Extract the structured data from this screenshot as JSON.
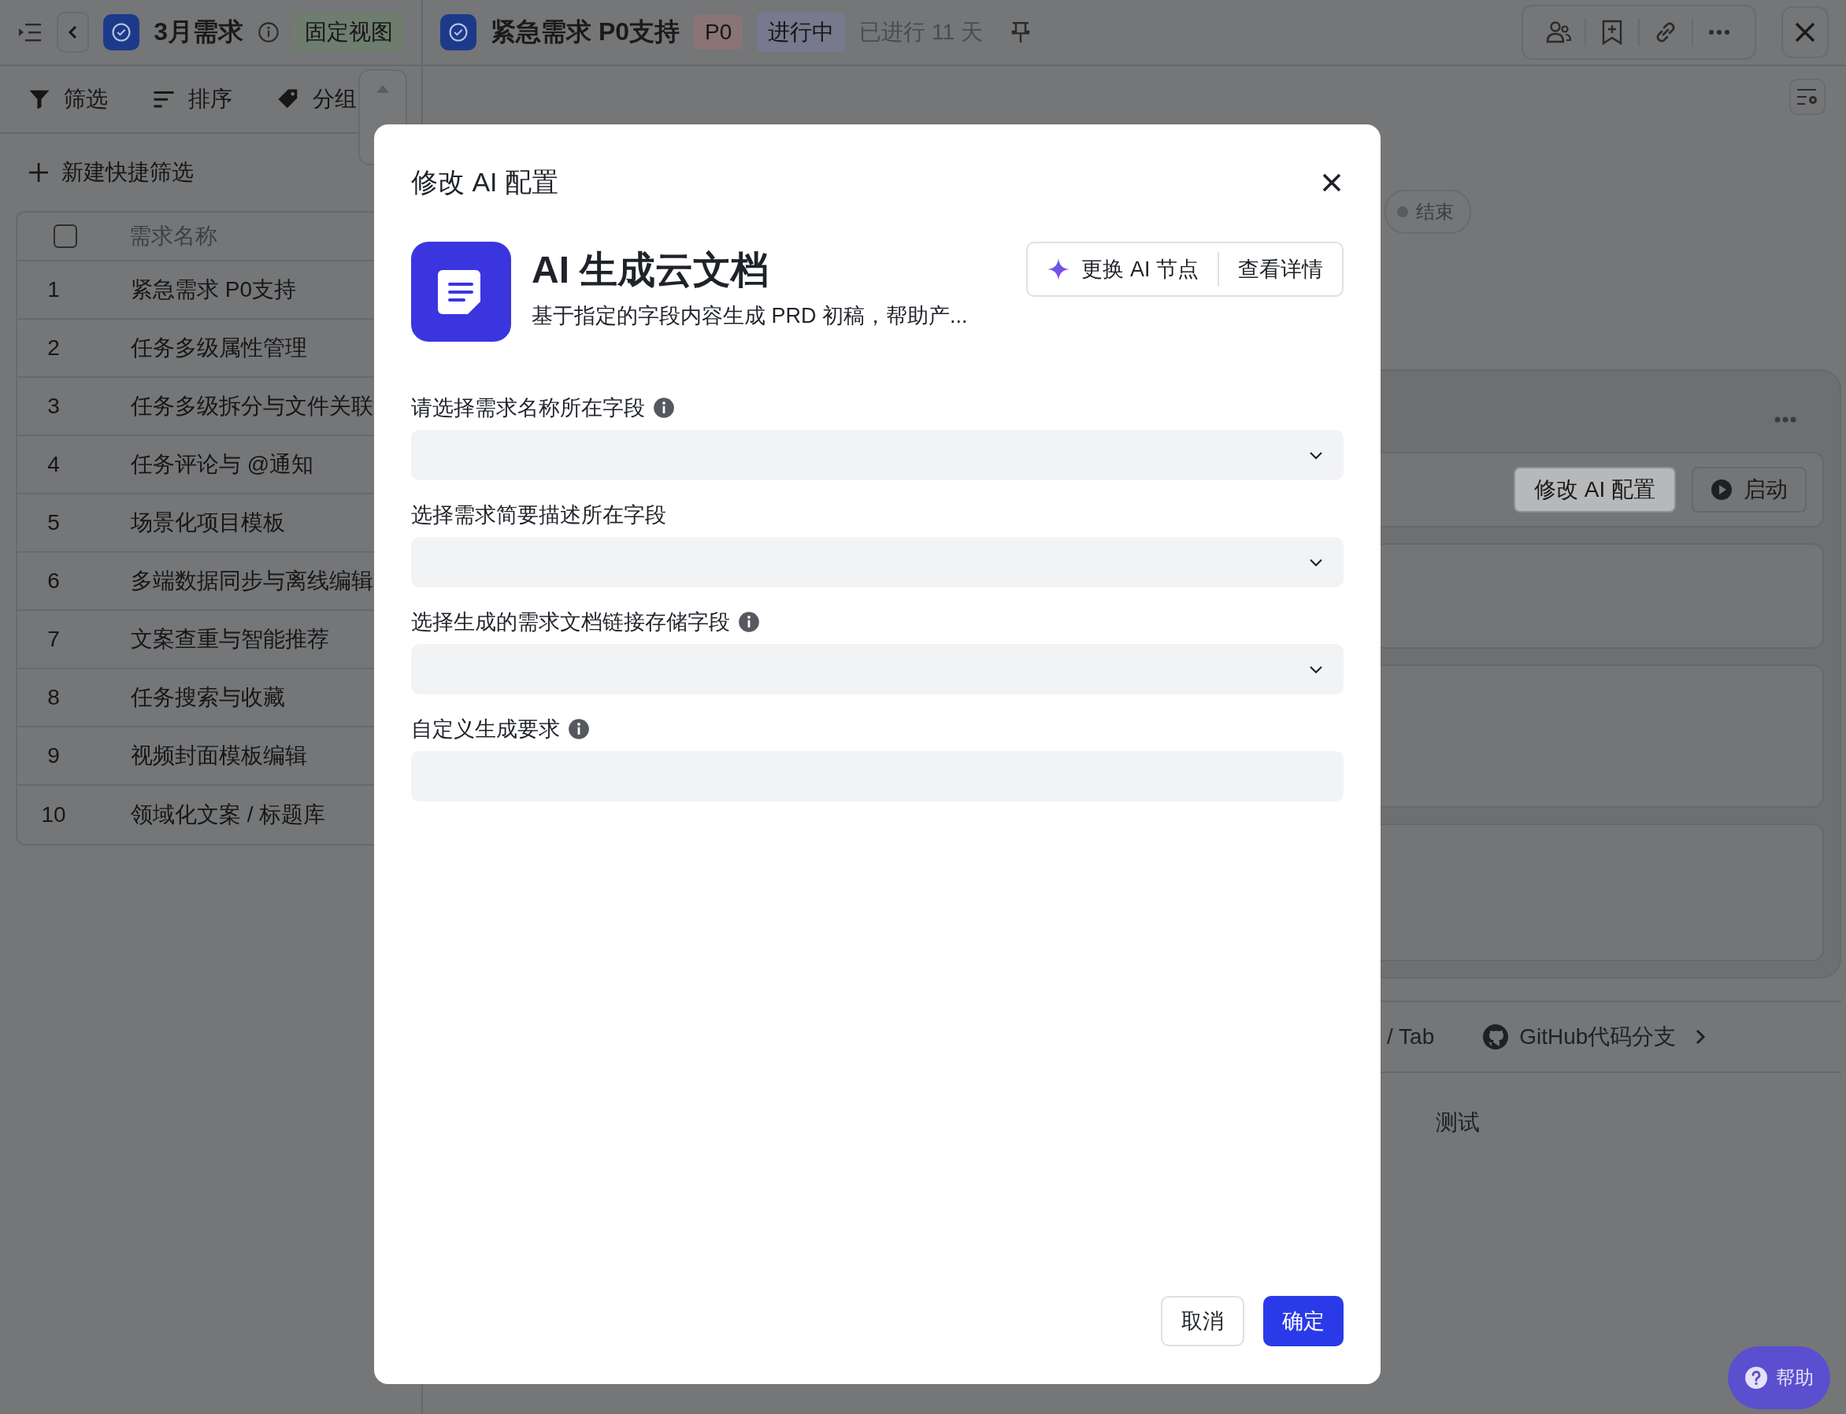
{
  "left_header": {
    "title": "3月需求",
    "view_tag": "固定视图"
  },
  "record_header": {
    "title": "紧急需求 P0支持",
    "priority": "P0",
    "status": "进行中",
    "elapsed": "已进行 11 天"
  },
  "toolbar": [
    {
      "label": "筛选",
      "kind": "filter"
    },
    {
      "label": "排序",
      "kind": "sort"
    },
    {
      "label": "分组",
      "kind": "group"
    }
  ],
  "quick_filter": "新建快捷筛选",
  "table": {
    "select_all_checked": false,
    "columns": [
      "需求名称"
    ],
    "rows": [
      {
        "index": "1",
        "name": "紧急需求 P0支持"
      },
      {
        "index": "2",
        "name": "任务多级属性管理"
      },
      {
        "index": "3",
        "name": "任务多级拆分与文件关联"
      },
      {
        "index": "4",
        "name": "任务评论与 @通知"
      },
      {
        "index": "5",
        "name": "场景化项目模板"
      },
      {
        "index": "6",
        "name": "多端数据同步与离线编辑"
      },
      {
        "index": "7",
        "name": "文案查重与智能推荐"
      },
      {
        "index": "8",
        "name": "任务搜索与收藏"
      },
      {
        "index": "9",
        "name": "视频封面模板编辑"
      },
      {
        "index": "10",
        "name": "领域化文案 / 标题库"
      }
    ]
  },
  "flow": {
    "end_node": "结束",
    "edit_button": "修改 AI 配置",
    "start_button": "启动"
  },
  "links": {
    "tab_label": "/ Tab",
    "github": "GitHub代码分支",
    "test": "测试"
  },
  "help": "帮助",
  "dialog": {
    "title": "修改 AI 配置",
    "node": {
      "name": "AI 生成云文档",
      "description": "基于指定的字段内容生成 PRD 初稿，帮助产...",
      "replace_button": "更换 AI 节点",
      "details_button": "查看详情"
    },
    "fields": [
      {
        "label": "请选择需求名称所在字段",
        "info": true,
        "kind": "select"
      },
      {
        "label": "选择需求简要描述所在字段",
        "info": false,
        "kind": "select"
      },
      {
        "label": "选择生成的需求文档链接存储字段",
        "info": true,
        "kind": "select"
      },
      {
        "label": "自定义生成要求",
        "info": true,
        "kind": "text"
      }
    ],
    "cancel": "取消",
    "confirm": "确定"
  }
}
